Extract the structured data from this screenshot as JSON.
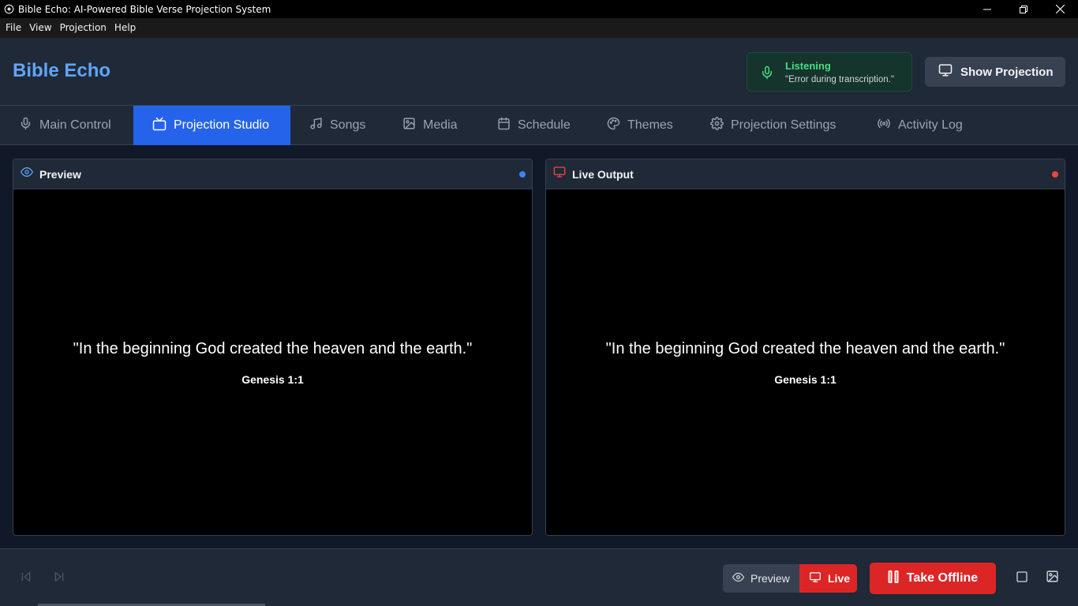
{
  "window": {
    "title": "Bible Echo: AI-Powered Bible Verse Projection System"
  },
  "menu": [
    "File",
    "View",
    "Projection",
    "Help"
  ],
  "header": {
    "brand": "Bible Echo",
    "status_title": "Listening",
    "status_message": "\"Error during transcription.\"",
    "show_projection_label": "Show Projection"
  },
  "tabs": [
    {
      "label": "Main Control",
      "icon": "mic-icon"
    },
    {
      "label": "Projection Studio",
      "icon": "tv-icon",
      "active": true
    },
    {
      "label": "Songs",
      "icon": "music-icon"
    },
    {
      "label": "Media",
      "icon": "image-icon"
    },
    {
      "label": "Schedule",
      "icon": "calendar-icon"
    },
    {
      "label": "Themes",
      "icon": "palette-icon"
    },
    {
      "label": "Projection Settings",
      "icon": "gear-icon"
    },
    {
      "label": "Activity Log",
      "icon": "broadcast-icon"
    }
  ],
  "preview_panel": {
    "title": "Preview",
    "verse": "\"In the beginning God created the heaven and the earth.\"",
    "reference": "Genesis 1:1",
    "indicator_color": "#3b82f6"
  },
  "live_panel": {
    "title": "Live Output",
    "verse": "\"In the beginning God created the heaven and the earth.\"",
    "reference": "Genesis 1:1",
    "indicator_color": "#ef4444"
  },
  "controls": {
    "preview_label": "Preview",
    "live_label": "Live",
    "take_offline_label": "Take Offline"
  },
  "colors": {
    "accent": "#2563eb",
    "brand": "#60a5fa",
    "live": "#dc2626",
    "listening": "#4ade80"
  }
}
